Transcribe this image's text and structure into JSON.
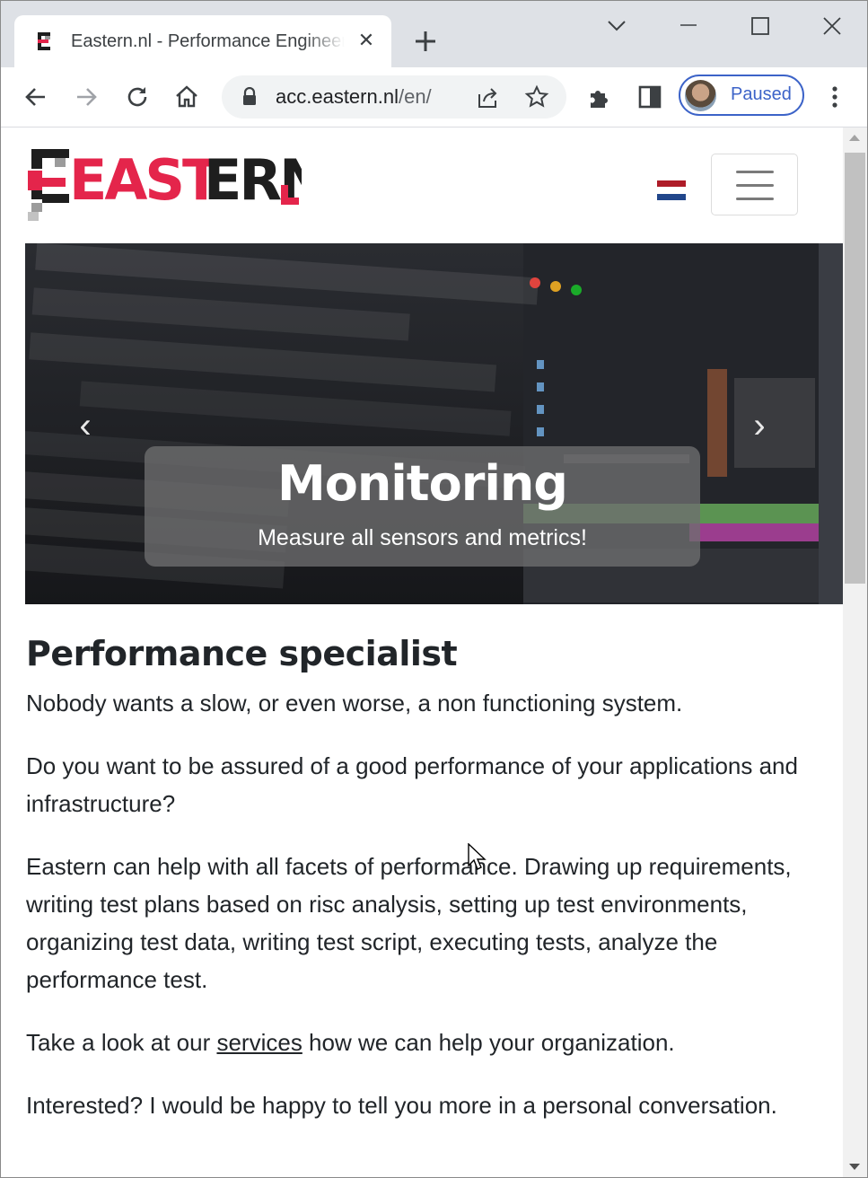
{
  "browser": {
    "tab": {
      "title": "Eastern.nl - Performance Engineering",
      "close_glyph": "✕"
    },
    "address": {
      "host": "acc.eastern.nl",
      "path": "/en/"
    },
    "profile": {
      "status": "Paused"
    },
    "colors": {
      "tabstrip": "#dee1e6",
      "profile_accent": "#3c63c8"
    },
    "icons": [
      "favicon-icon",
      "close-icon",
      "plus-icon",
      "chevron-down-icon",
      "minimize-icon",
      "maximize-icon",
      "window-close-icon",
      "back-icon",
      "forward-icon",
      "reload-icon",
      "home-icon",
      "lock-icon",
      "share-icon",
      "star-icon",
      "extensions-icon",
      "side-panel-icon",
      "menu-dots-icon"
    ]
  },
  "site": {
    "logo_text": "EASTERN",
    "colors": {
      "brand_red": "#e4254b",
      "brand_dark": "#1e1e1e"
    },
    "carousel": {
      "prev_glyph": "‹",
      "next_glyph": "›",
      "caption_title": "Monitoring",
      "caption_text": "Measure all sensors and metrics!"
    },
    "article": {
      "heading": "Performance specialist",
      "p1": "Nobody wants a slow, or even worse, a non functioning system.",
      "p2": "Do you want to be assured of a good performance of your applications and infrastructure?",
      "p3": "Eastern can help with all facets of performance. Drawing up requirements, writing test plans based on risc analysis, setting up test environments, organizing test data, writing test script, executing tests, analyze the performance test.",
      "p4_before": "Take a look at our ",
      "p4_link": "services",
      "p4_after": " how we can help your organization.",
      "p5": "Interested? I would be happy to tell you more in a personal conversation."
    }
  }
}
